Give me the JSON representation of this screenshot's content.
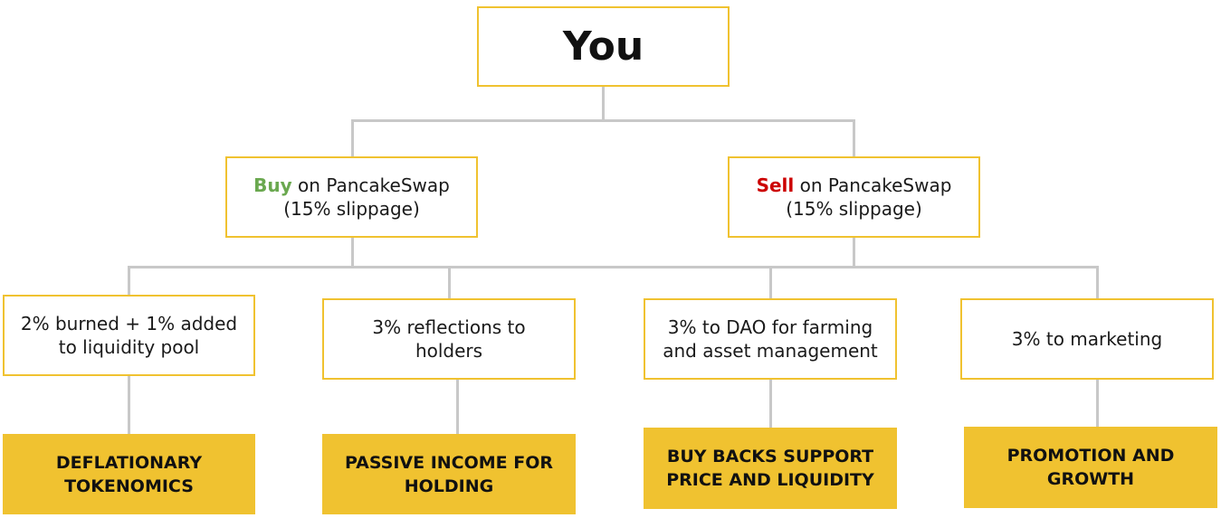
{
  "root": {
    "label": "You"
  },
  "actions": [
    {
      "keyword": "Buy",
      "rest": " on PancakeSwap",
      "detail": "(15% slippage)",
      "color": "#6aa84f"
    },
    {
      "keyword": "Sell",
      "rest": " on PancakeSwap",
      "detail": "(15% slippage)",
      "color": "#cc0000"
    }
  ],
  "allocations": [
    {
      "line1": "2% burned + 1% added",
      "line2": "to liquidity pool"
    },
    {
      "line1": "3% reflections to",
      "line2": "holders"
    },
    {
      "line1": "3% to DAO for farming",
      "line2": "and asset management"
    },
    {
      "line1": "3% to marketing",
      "line2": ""
    }
  ],
  "outcomes": [
    {
      "line1": "DEFLATIONARY",
      "line2": "TOKENOMICS"
    },
    {
      "line1": "PASSIVE INCOME FOR",
      "line2": "HOLDING"
    },
    {
      "line1": "BUY BACKS SUPPORT",
      "line2": "PRICE AND LIQUIDITY"
    },
    {
      "line1": "PROMOTION AND",
      "line2": "GROWTH"
    }
  ],
  "colors": {
    "box_border": "#f0c230",
    "outcome_fill": "#f0c230",
    "connector": "#c8c8c8"
  }
}
